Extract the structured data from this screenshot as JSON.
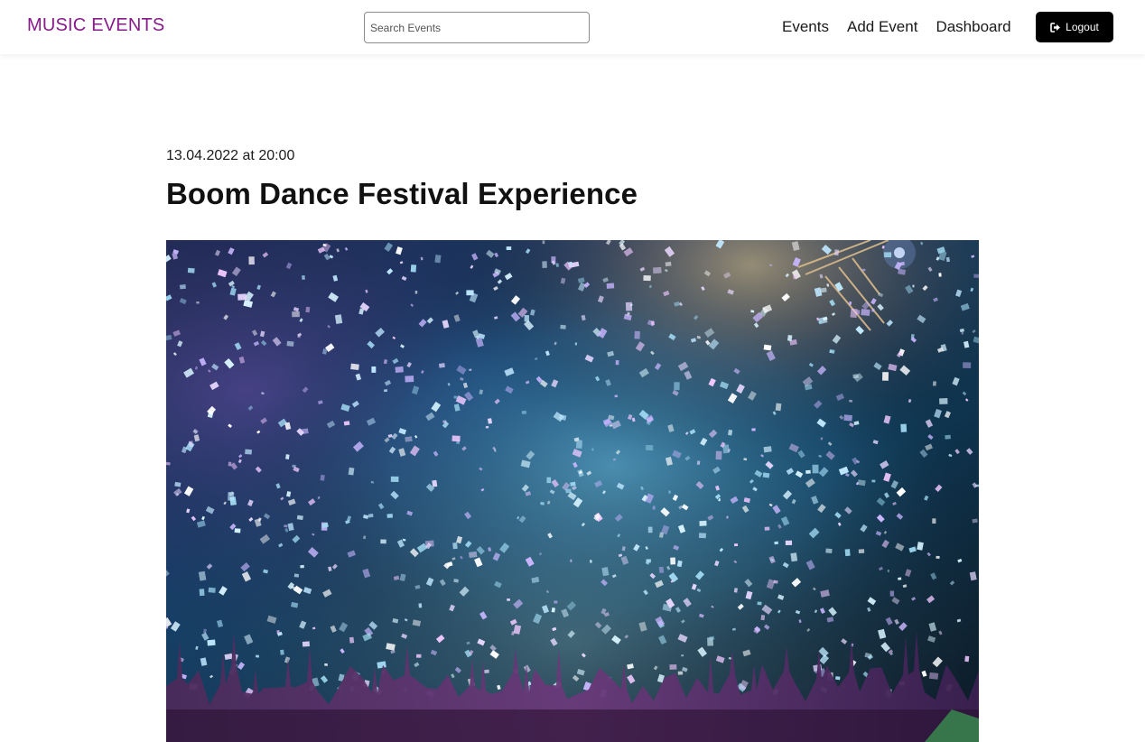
{
  "header": {
    "brand": "MUSIC EVENTS",
    "search_placeholder": "Search Events",
    "nav": [
      {
        "label": "Events"
      },
      {
        "label": "Add Event"
      },
      {
        "label": "Dashboard"
      }
    ],
    "logout_label": "Logout",
    "logout_icon": "sign-out-icon"
  },
  "event": {
    "date": "13.04.2022 at 20:00",
    "title": "Boom Dance Festival Experience",
    "image_alt": "concert-confetti-photo"
  },
  "colors": {
    "brand": "#8a1a8c",
    "button_bg": "#000000",
    "button_text": "#ffffff"
  }
}
